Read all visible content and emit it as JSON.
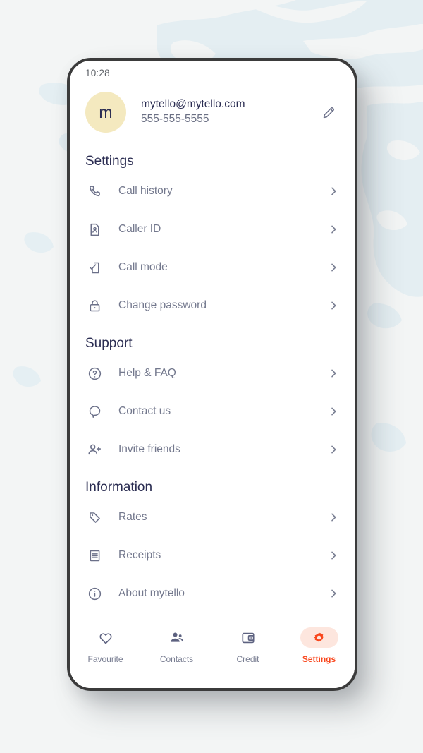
{
  "background": {
    "base_color": "#f3f5f5",
    "map_color": "#e3edf1"
  },
  "theme": {
    "accent": "#f9461c",
    "accent_soft": "#fde6de",
    "heading_color": "#2b2d52",
    "label_color": "#73788d",
    "icon_color": "#6b7089",
    "avatar_bg": "#f4e9bf",
    "frame_color": "#3b3b3b"
  },
  "status_bar": {
    "time": "10:28"
  },
  "profile": {
    "avatar_initial": "m",
    "email": "mytello@mytello.com",
    "phone": "555-555-5555",
    "edit_icon": "pencil-icon"
  },
  "sections": [
    {
      "title": "Settings",
      "items": [
        {
          "label": "Call history",
          "icon": "phone-icon",
          "name": "call-history"
        },
        {
          "label": "Caller ID",
          "icon": "contact-card-icon",
          "name": "caller-id"
        },
        {
          "label": "Call mode",
          "icon": "phone-check-icon",
          "name": "call-mode"
        },
        {
          "label": "Change password",
          "icon": "lock-icon",
          "name": "change-password"
        }
      ]
    },
    {
      "title": "Support",
      "items": [
        {
          "label": "Help & FAQ",
          "icon": "question-circle-icon",
          "name": "help-faq"
        },
        {
          "label": "Contact us",
          "icon": "chat-bubble-icon",
          "name": "contact-us"
        },
        {
          "label": "Invite friends",
          "icon": "person-add-icon",
          "name": "invite-friends"
        }
      ]
    },
    {
      "title": "Information",
      "items": [
        {
          "label": "Rates",
          "icon": "tag-icon",
          "name": "rates"
        },
        {
          "label": "Receipts",
          "icon": "receipt-icon",
          "name": "receipts"
        },
        {
          "label": "About mytello",
          "icon": "info-circle-icon",
          "name": "about-mytello"
        }
      ]
    }
  ],
  "bottom_nav": {
    "items": [
      {
        "label": "Favourite",
        "icon": "heart-icon",
        "active": false
      },
      {
        "label": "Contacts",
        "icon": "people-icon",
        "active": false
      },
      {
        "label": "Credit",
        "icon": "wallet-icon",
        "active": false
      },
      {
        "label": "Settings",
        "icon": "gear-icon",
        "active": true
      }
    ]
  }
}
